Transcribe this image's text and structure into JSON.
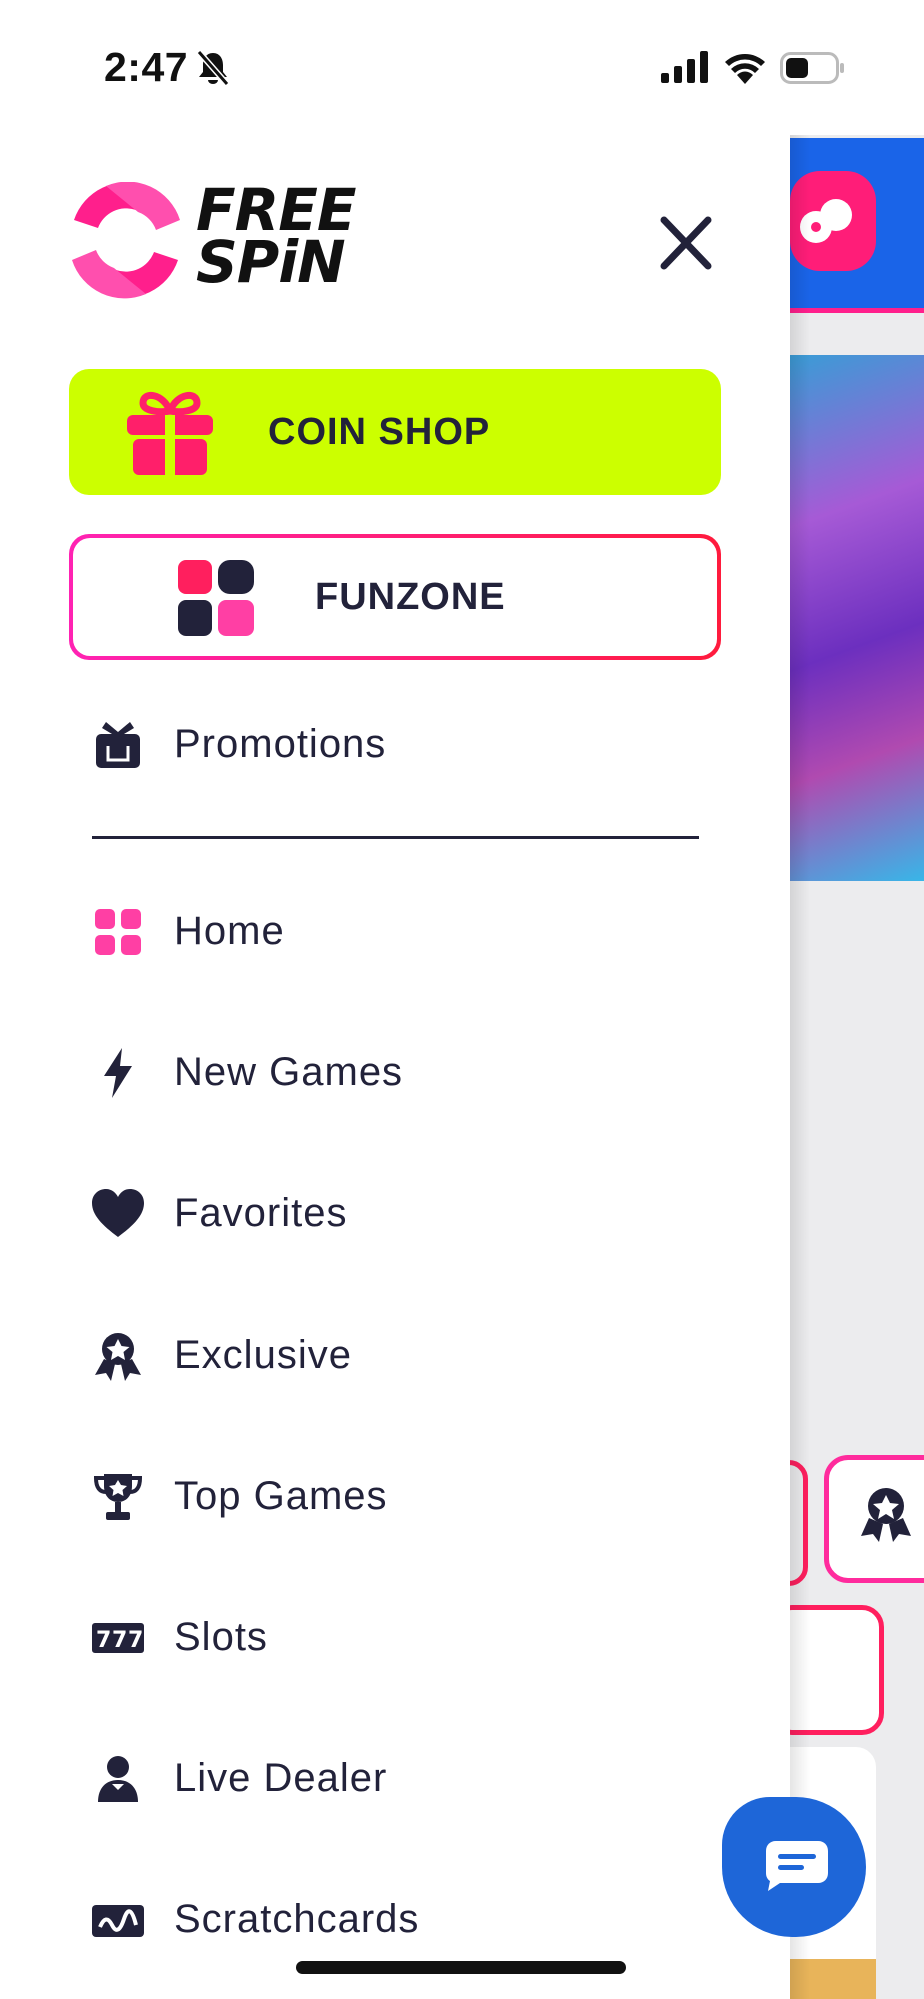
{
  "status_bar": {
    "time": "2:47"
  },
  "brand": {
    "logo_text_line1": "FREE",
    "logo_text_line2": "SPiN",
    "accent_pink": "#ff1f8c",
    "accent_lime": "#ccff00",
    "text_dark": "#22223a"
  },
  "buttons": {
    "coin_shop": "COIN SHOP",
    "funzone": "FUNZONE"
  },
  "promotions": {
    "label": "Promotions"
  },
  "menu": [
    {
      "label": "Home",
      "icon": "grid-icon"
    },
    {
      "label": "New Games",
      "icon": "lightning-icon"
    },
    {
      "label": "Favorites",
      "icon": "heart-icon"
    },
    {
      "label": "Exclusive",
      "icon": "badge-icon"
    },
    {
      "label": "Top Games",
      "icon": "trophy-icon"
    },
    {
      "label": "Slots",
      "icon": "slots-icon"
    },
    {
      "label": "Live Dealer",
      "icon": "dealer-icon"
    },
    {
      "label": "Scratchcards",
      "icon": "scratchcard-icon"
    }
  ]
}
